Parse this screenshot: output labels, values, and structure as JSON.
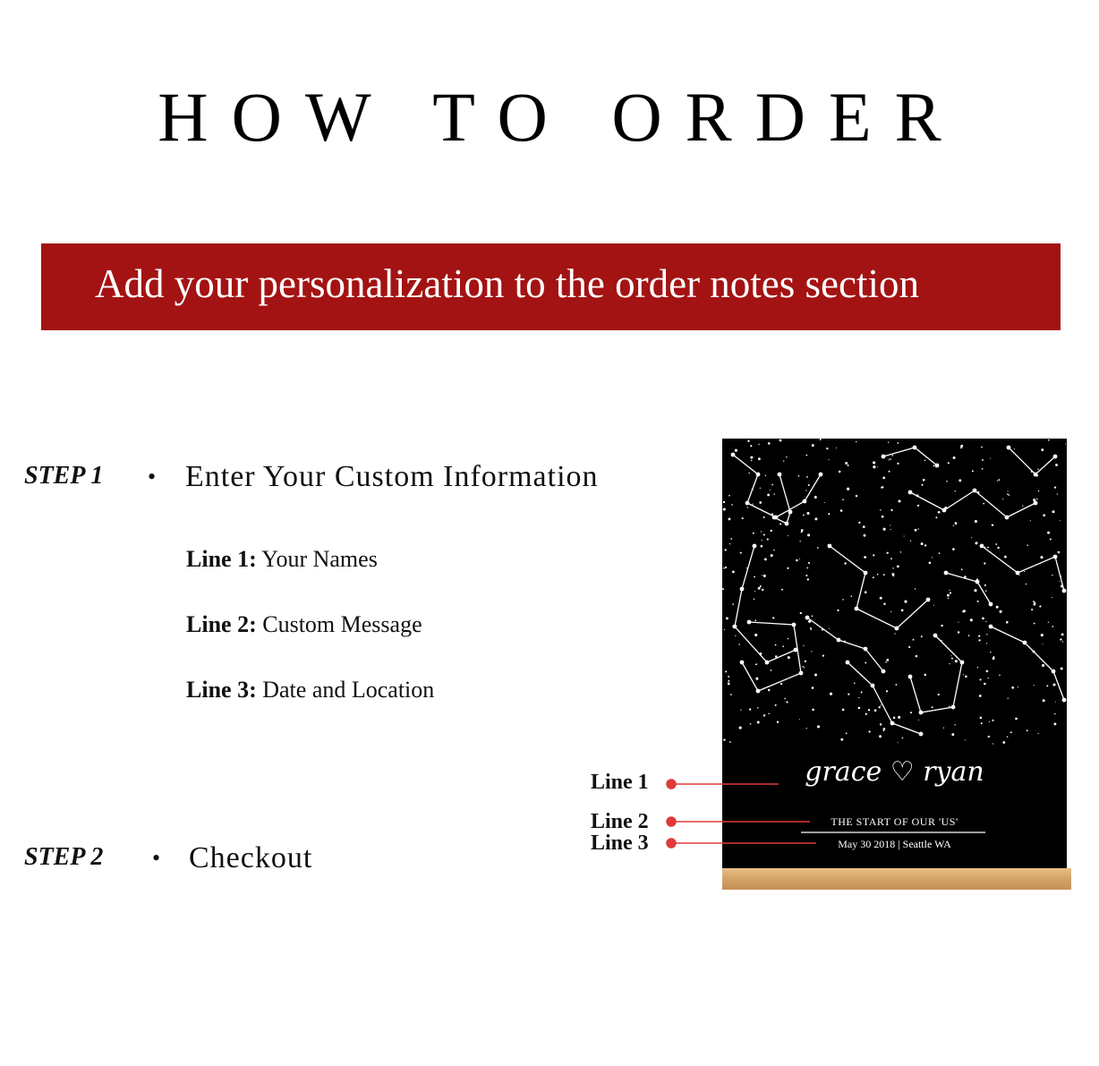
{
  "header": {
    "title": "HOW TO ORDER"
  },
  "banner": {
    "text": "Add your personalization to the order notes section"
  },
  "steps": [
    {
      "label": "STEP 1",
      "bullet": "•",
      "text": "Enter Your Custom Information",
      "lines": [
        {
          "label": "Line 1:",
          "value": "Your Names"
        },
        {
          "label": "Line 2:",
          "value": "Custom Message"
        },
        {
          "label": "Line 3:",
          "value": "Date and Location"
        }
      ]
    },
    {
      "label": "STEP 2",
      "bullet": "•",
      "text": "Checkout"
    }
  ],
  "preview": {
    "callouts": [
      "Line 1",
      "Line 2",
      "Line 3"
    ],
    "line1": "grace ♡ ryan",
    "line2": "THE START OF OUR 'US'",
    "line3": "May 30 2018  |  Seattle WA",
    "background_color": "#000000",
    "callout_color": "#e03a3a"
  }
}
